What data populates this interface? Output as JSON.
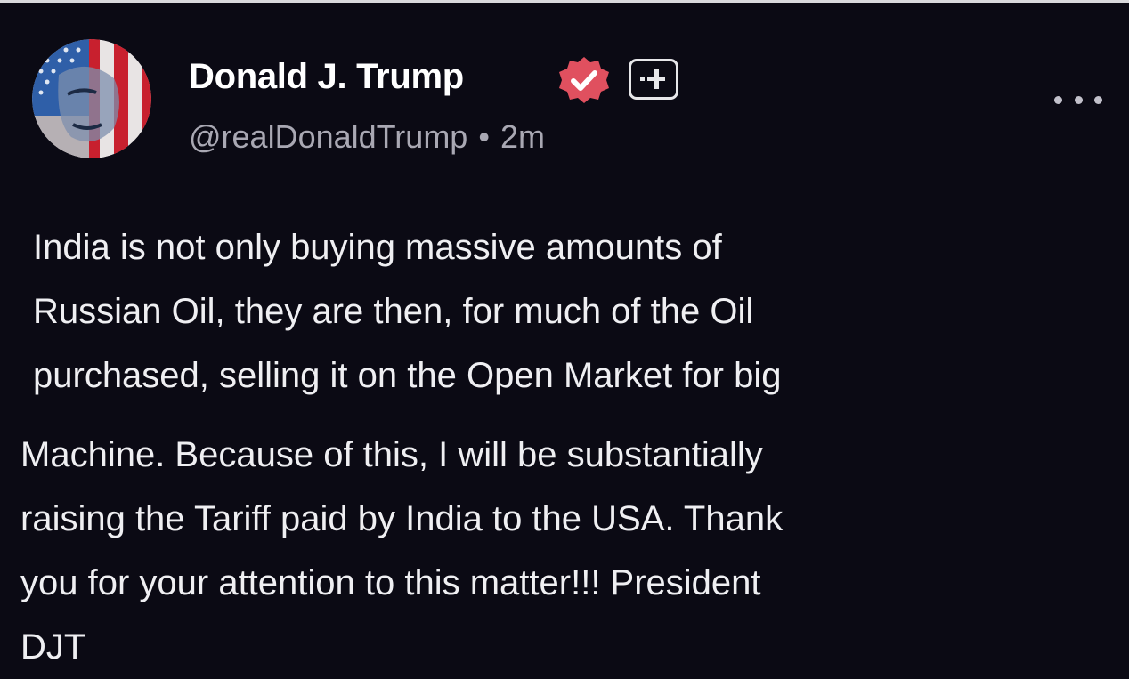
{
  "post": {
    "author": {
      "name": "Donald J. Trump",
      "handle": "@realDonaldTrump",
      "separator": "•",
      "time": "2m",
      "avatar_icon": "flag-portrait-avatar",
      "verified_icon": "verified-check-icon",
      "badge_icon": "plus-badge-icon"
    },
    "menu_icon": "more-options-icon",
    "body": {
      "paragraph1": [
        "India is not only buying massive amounts of",
        "Russian Oil, they are then, for much of the Oil",
        "purchased, selling it on the Open Market for big"
      ],
      "paragraph2": [
        "Machine. Because of this, I will be substantially",
        "raising the Tariff paid by India to the USA. Thank",
        "you for your attention to this matter!!! President",
        "DJT"
      ]
    }
  },
  "colors": {
    "background": "#0b0a14",
    "text": "#efeff2",
    "muted": "#a9a8b3",
    "verified": "#e0505f"
  }
}
